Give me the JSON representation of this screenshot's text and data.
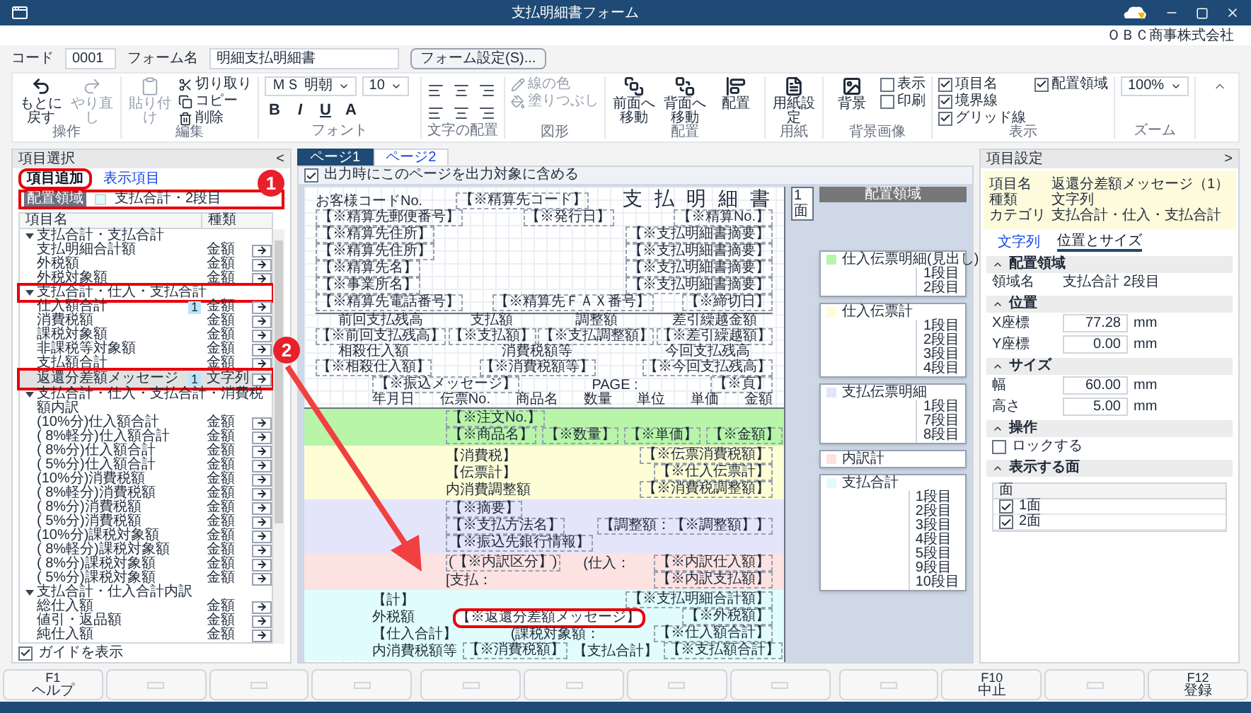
{
  "window": {
    "title": "支払明細書フォーム"
  },
  "company": "ＯＢＣ商事株式会社",
  "form": {
    "code_label": "コード",
    "code": "0001",
    "name_label": "フォーム名",
    "name": "明細支払明細書",
    "settings_button": "フォーム設定(S)..."
  },
  "ribbon": {
    "groups": [
      {
        "label": "操作",
        "kind": "tools",
        "items": [
          {
            "kind": "big",
            "label": "もとに戻す",
            "disabled": false
          },
          {
            "kind": "big",
            "label": "やり直し",
            "disabled": true
          }
        ]
      },
      {
        "label": "編集",
        "kind": "tools",
        "items": [
          {
            "kind": "big",
            "label": "貼り付け",
            "disabled": true
          },
          {
            "kind": "small",
            "label": "切り取り",
            "disabled": false
          },
          {
            "kind": "small",
            "label": "コピー",
            "disabled": false
          },
          {
            "kind": "small",
            "label": "削除",
            "disabled": false
          }
        ]
      },
      {
        "label": "フォント",
        "kind": "tools",
        "items": [
          {
            "kind": "select",
            "label": "ＭＳ 明朝"
          },
          {
            "kind": "select",
            "label": "10"
          },
          {
            "kind": "tool",
            "label": "B"
          },
          {
            "kind": "tool",
            "label": "I"
          },
          {
            "kind": "tool",
            "label": "U"
          },
          {
            "kind": "tool",
            "label": "A"
          }
        ]
      },
      {
        "label": "文字の配置",
        "kind": "align"
      },
      {
        "label": "図形",
        "kind": "tools",
        "items": [
          {
            "kind": "small",
            "label": "線の色",
            "disabled": true
          },
          {
            "kind": "small",
            "label": "塗りつぶし",
            "disabled": true
          }
        ]
      },
      {
        "label": "配置",
        "kind": "tools",
        "items": [
          {
            "kind": "big",
            "label": "前面へ移動",
            "disabled": false
          },
          {
            "kind": "big",
            "label": "背面へ移動",
            "disabled": false
          },
          {
            "kind": "big",
            "label": "配置",
            "disabled": false
          }
        ]
      },
      {
        "label": "用紙",
        "kind": "tools",
        "items": [
          {
            "kind": "big",
            "label": "用紙設定",
            "disabled": false
          }
        ]
      },
      {
        "label": "背景画像",
        "kind": "tools",
        "items": [
          {
            "kind": "big",
            "label": "背景",
            "disabled": false
          },
          {
            "kind": "check",
            "label": "表示",
            "checked": false
          },
          {
            "kind": "check",
            "label": "印刷",
            "checked": false
          }
        ]
      },
      {
        "label": "表示",
        "kind": "tools",
        "items": [
          {
            "kind": "check",
            "label": "項目名",
            "checked": true
          },
          {
            "kind": "check",
            "label": "境界線",
            "checked": true
          },
          {
            "kind": "check",
            "label": "グリッド線",
            "checked": true
          },
          {
            "kind": "check",
            "label": "配置領域",
            "checked": true
          }
        ]
      },
      {
        "label": "ズーム",
        "kind": "tools",
        "items": [
          {
            "kind": "select",
            "label": "100%"
          }
        ]
      }
    ]
  },
  "item_panel": {
    "title": "項目選択",
    "collapse": "<",
    "tabs": [
      {
        "label": "項目追加",
        "selected": true,
        "callout": true
      },
      {
        "label": "表示項目",
        "selected": false,
        "callout": false
      }
    ],
    "area": {
      "tag": "配置領域",
      "value": "支払合計・2段目",
      "callout": true
    },
    "columns": [
      "項目名",
      "種類"
    ],
    "groups": [
      {
        "label": "支払合計・支払合計",
        "expanded": true,
        "callout": false,
        "children": [
          {
            "name": "支払明細合計額",
            "type": "金額",
            "selected": false,
            "callout": false
          },
          {
            "name": "外税額",
            "type": "金額",
            "selected": false,
            "callout": false
          },
          {
            "name": "外税対象額",
            "type": "金額",
            "selected": false,
            "callout": false
          }
        ]
      },
      {
        "label": "支払合計・仕入・支払合計",
        "expanded": true,
        "callout": true,
        "children": [
          {
            "name": "仕入額合計",
            "count": "1",
            "type": "金額",
            "selected": false,
            "callout": false
          },
          {
            "name": "消費税額",
            "type": "金額",
            "selected": false,
            "callout": false
          },
          {
            "name": "課税対象額",
            "type": "金額",
            "selected": false,
            "callout": false
          },
          {
            "name": "非課税等対象額",
            "type": "金額",
            "selected": false,
            "callout": false
          },
          {
            "name": "支払額合計",
            "type": "金額",
            "selected": false,
            "callout": false
          },
          {
            "name": "返還分差額メッセージ",
            "count": "1",
            "type": "文字列",
            "selected": true,
            "callout": true
          }
        ]
      },
      {
        "label": "支払合計・仕入・支払合計・消費税額内訳",
        "expanded": true,
        "callout": false,
        "children": [
          {
            "name": "(10%分)仕入額合計",
            "type": "金額",
            "selected": false,
            "callout": false
          },
          {
            "name": "( 8%軽分)仕入額合計",
            "type": "金額",
            "selected": false,
            "callout": false
          },
          {
            "name": "( 8%分)仕入額合計",
            "type": "金額",
            "selected": false,
            "callout": false
          },
          {
            "name": "( 5%分)仕入額合計",
            "type": "金額",
            "selected": false,
            "callout": false
          },
          {
            "name": "(10%分)消費税額",
            "type": "金額",
            "selected": false,
            "callout": false
          },
          {
            "name": "( 8%軽分)消費税額",
            "type": "金額",
            "selected": false,
            "callout": false
          },
          {
            "name": "( 8%分)消費税額",
            "type": "金額",
            "selected": false,
            "callout": false
          },
          {
            "name": "( 5%分)消費税額",
            "type": "金額",
            "selected": false,
            "callout": false
          },
          {
            "name": "(10%分)課税対象額",
            "type": "金額",
            "selected": false,
            "callout": false
          },
          {
            "name": "( 8%軽分)課税対象額",
            "type": "金額",
            "selected": false,
            "callout": false
          },
          {
            "name": "( 8%分)課税対象額",
            "type": "金額",
            "selected": false,
            "callout": false
          },
          {
            "name": "( 5%分)課税対象額",
            "type": "金額",
            "selected": false,
            "callout": false
          }
        ]
      },
      {
        "label": "支払合計・仕入合計内訳",
        "expanded": true,
        "callout": false,
        "children": [
          {
            "name": "総仕入額",
            "type": "金額",
            "selected": false,
            "callout": false
          },
          {
            "name": "値引・返品額",
            "type": "金額",
            "selected": false,
            "callout": false
          },
          {
            "name": "純仕入額",
            "type": "金額",
            "selected": false,
            "callout": false
          }
        ]
      }
    ],
    "guide": {
      "label": "ガイドを表示",
      "checked": true
    }
  },
  "callouts": [
    "1",
    "2"
  ],
  "designer": {
    "tabs": [
      {
        "label": "ページ1",
        "selected": true
      },
      {
        "label": "ページ2",
        "selected": false
      }
    ],
    "include_page": {
      "label": "出力時にこのページを出力対象に含める",
      "checked": true
    },
    "header_lines": [
      [
        {
          "kind": "text",
          "text": "お客様コードNo."
        },
        {
          "kind": "field",
          "text": "【※精算先コード】"
        },
        {
          "kind": "title",
          "text": "支 払 明 細 書"
        }
      ],
      [
        {
          "kind": "field",
          "text": "【※精算先郵便番号】"
        },
        {
          "kind": "field",
          "text": "【※発行日】"
        },
        {
          "kind": "field",
          "text": "【※精算No.】"
        }
      ],
      [
        {
          "kind": "field",
          "text": "【※精算先住所】"
        },
        {
          "kind": "field",
          "text": "【※支払明細書摘要】"
        }
      ],
      [
        {
          "kind": "field",
          "text": "【※精算先住所】"
        },
        {
          "kind": "field",
          "text": "【※支払明細書摘要】"
        }
      ],
      [
        {
          "kind": "field",
          "text": "【※精算先名】"
        },
        {
          "kind": "field",
          "text": "【※支払明細書摘要】"
        }
      ],
      [
        {
          "kind": "field",
          "text": "【※事業所名】"
        },
        {
          "kind": "field",
          "text": "【※支払明細書摘要】"
        }
      ],
      [
        {
          "kind": "field",
          "text": "【※精算先電話番号】"
        },
        {
          "kind": "field",
          "text": "【※精算先ＦＡＸ番号】"
        },
        {
          "kind": "field",
          "text": "【※締切日】"
        }
      ]
    ],
    "summary": [
      {
        "label": "前回支払残高",
        "field": "【※前回支払残高】"
      },
      {
        "label": "支払額",
        "field": "【※支払額】"
      },
      {
        "label": "調整額",
        "field": "【※支払調整額】"
      },
      {
        "label": "差引繰越金額",
        "field": "【※差引繰越額】"
      },
      {
        "label": "相殺仕入額",
        "field": "【※相殺仕入額】"
      },
      {
        "label": "消費税額等",
        "field": "【※消費税額等】"
      },
      {
        "label": "今回支払残高",
        "field": "【※今回支払残高】"
      }
    ],
    "message_lines": [
      [
        {
          "kind": "field",
          "text": "【※振込メッセージ】"
        },
        {
          "kind": "text",
          "text": "PAGE :"
        },
        {
          "kind": "field",
          "text": "【※頁】"
        }
      ],
      [
        {
          "kind": "text",
          "text": "年月日"
        },
        {
          "kind": "text",
          "text": "伝票No."
        },
        {
          "kind": "text",
          "text": "商品名"
        },
        {
          "kind": "text",
          "text": "数量"
        },
        {
          "kind": "text",
          "text": "単位"
        },
        {
          "kind": "text",
          "text": "単価"
        },
        {
          "kind": "text",
          "text": "金額"
        }
      ]
    ],
    "bands": [
      {
        "color": "#b8f5a8",
        "lines": [
          [
            {
              "kind": "field",
              "text": "【※注文No.】"
            }
          ],
          [
            {
              "kind": "field",
              "text": "【※商品名】"
            },
            {
              "kind": "field",
              "text": "【※数量】"
            },
            {
              "kind": "field",
              "text": "【※単価】"
            },
            {
              "kind": "field",
              "text": "【※金額】"
            }
          ]
        ]
      },
      {
        "color": "#fdfdd6",
        "lines": [
          [
            {
              "kind": "text",
              "text": "【消費税】"
            },
            {
              "kind": "field",
              "text": "【※伝票消費税額】"
            }
          ],
          [
            {
              "kind": "text",
              "text": "【伝票計】"
            },
            {
              "kind": "field",
              "text": "【※仕入伝票計】"
            }
          ],
          [
            {
              "kind": "text",
              "text": "内消費調整額"
            },
            {
              "kind": "field",
              "text": "【※消費税調整額】"
            }
          ]
        ]
      },
      {
        "color": "#e4e4fb",
        "lines": [
          [
            {
              "kind": "field",
              "text": "【※摘要】"
            }
          ],
          [
            {
              "kind": "field",
              "text": "【※支払方法名】"
            },
            {
              "kind": "field",
              "text": "【調整額：【※調整額】】"
            }
          ],
          [
            {
              "kind": "field",
              "text": "【※振込先銀行情報】"
            }
          ]
        ]
      },
      {
        "color": "#fde2e2",
        "lines": [
          [
            {
              "kind": "field",
              "text": "(【※内訳区分】)"
            },
            {
              "kind": "text",
              "text": "(仕入："
            },
            {
              "kind": "field",
              "text": "【※内訳仕入額】"
            }
          ],
          [
            {
              "kind": "text",
              "text": "[支払："
            },
            {
              "kind": "field",
              "text": "【※内訳支払額】"
            }
          ]
        ]
      },
      {
        "color": "#e0fcfc",
        "lines": [
          [
            {
              "kind": "text",
              "text": "【計】"
            },
            {
              "kind": "field",
              "text": "【※支払明細合計額】"
            }
          ],
          [
            {
              "kind": "text",
              "text": "外税額"
            },
            {
              "kind": "field",
              "text": "【※返還分差額メッセージ】",
              "selected": true
            },
            {
              "kind": "field",
              "text": "【※外税額】"
            }
          ],
          [
            {
              "kind": "text",
              "text": "【仕入合計】"
            },
            {
              "kind": "text",
              "text": "(課税対象額："
            },
            {
              "kind": "field",
              "text": "【※仕入額合計】"
            }
          ],
          [
            {
              "kind": "text",
              "text": "内消費税額等"
            },
            {
              "kind": "field",
              "text": "【※消費税額】"
            },
            {
              "kind": "text",
              "text": "【支払合計】"
            },
            {
              "kind": "field",
              "text": "【※支払額合計】"
            }
          ]
        ]
      }
    ],
    "face": "1面",
    "area_title": "配置領域",
    "legend": [
      {
        "name": "仕入伝票明細(見出し)",
        "color": "#b8f5a8",
        "rows": [
          "1段目",
          "2段目"
        ]
      },
      {
        "name": "仕入伝票計",
        "color": "#fdfdd6",
        "rows": [
          "1段目",
          "2段目",
          "3段目",
          "4段目"
        ]
      },
      {
        "name": "支払伝票明細",
        "color": "#e4e4fb",
        "rows": [
          "1段目",
          "7段目",
          "8段目"
        ]
      },
      {
        "name": "内訳計",
        "color": "#fde2e2"
      },
      {
        "name": "支払合計",
        "color": "#e0fcfc",
        "rows": [
          "1段目",
          "2段目",
          "3段目",
          "4段目",
          "5段目",
          "9段目",
          "10段目"
        ]
      }
    ]
  },
  "settings": {
    "title": "項目設定",
    "collapse": ">",
    "info": [
      {
        "label": "項目名",
        "value": "返還分差額メッセージ（1）"
      },
      {
        "label": "種類",
        "value": "文字列"
      },
      {
        "label": "カテゴリ",
        "value": "支払合計・仕入・支払合計"
      }
    ],
    "tabs": [
      {
        "label": "文字列",
        "selected": false
      },
      {
        "label": "位置とサイズ",
        "selected": true
      }
    ],
    "sections": [
      {
        "title": "配置領域",
        "expanded": true,
        "rows": [
          {
            "kind": "text",
            "label": "領域名",
            "value": "支払合計 2段目"
          }
        ]
      },
      {
        "title": "位置",
        "expanded": true,
        "rows": [
          {
            "kind": "number",
            "label": "X座標",
            "value": "77.28",
            "unit": "mm"
          },
          {
            "kind": "number",
            "label": "Y座標",
            "value": "0.00",
            "unit": "mm"
          }
        ]
      },
      {
        "title": "サイズ",
        "expanded": true,
        "rows": [
          {
            "kind": "number",
            "label": "幅",
            "value": "60.00",
            "unit": "mm"
          },
          {
            "kind": "number",
            "label": "高さ",
            "value": "5.00",
            "unit": "mm"
          }
        ]
      },
      {
        "title": "操作",
        "expanded": true,
        "rows": [
          {
            "kind": "check",
            "label": "ロックする",
            "checked": false
          }
        ]
      },
      {
        "title": "表示する面",
        "expanded": true,
        "rows": [
          {
            "kind": "table",
            "header": "面",
            "items": [
              {
                "label": "1面",
                "checked": true
              },
              {
                "label": "2面",
                "checked": true
              }
            ]
          }
        ]
      }
    ]
  },
  "function_keys": [
    {
      "kind": "key",
      "key": "F1",
      "label": "ヘルプ"
    },
    {
      "kind": "blank"
    },
    {
      "kind": "blank"
    },
    {
      "kind": "blank"
    },
    {
      "kind": "blank"
    },
    {
      "kind": "blank"
    },
    {
      "kind": "blank"
    },
    {
      "kind": "blank"
    },
    {
      "kind": "blank"
    },
    {
      "kind": "key",
      "key": "F10",
      "label": "中止"
    },
    {
      "kind": "blank"
    },
    {
      "kind": "key",
      "key": "F12",
      "label": "登録"
    }
  ]
}
